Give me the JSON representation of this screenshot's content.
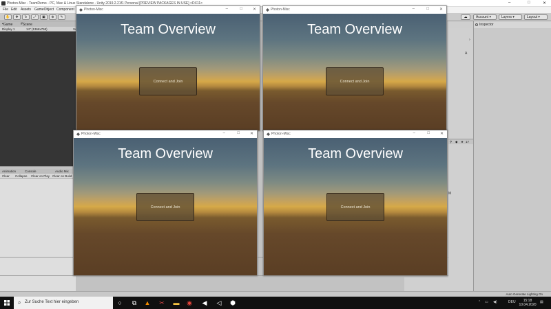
{
  "unity": {
    "title": "Photon-Misc - TeamDemo - PC, Mac & Linux Standalone - Unity 2019.2.21f1 Personal [PREVIEW PACKAGES IN USE] <DX11>",
    "menu": [
      "File",
      "Edit",
      "Assets",
      "GameObject",
      "Component"
    ],
    "toolbar": {
      "account": "Account",
      "layers": "Layers",
      "layout": "Layout"
    },
    "game_tabs": [
      "Game",
      "Scene"
    ],
    "display": "Display 1",
    "resolution": "14\" (1366x768)",
    "scale_prefix": "Sc",
    "console_tabs": [
      "Animation",
      "Console",
      "Audio Mix"
    ],
    "console_buttons": [
      "Clear",
      "Collapse",
      "Clear on Play",
      "Clear on Build"
    ],
    "inspector_tab": "Inspector",
    "project_count": "17",
    "status": "Auto Generate Lighting On"
  },
  "game_windows": [
    {
      "title": "Photon-Misc",
      "heading": "Team Overview",
      "button": "Connect and Join"
    },
    {
      "title": "Photon-Misc",
      "heading": "Team Overview",
      "button": "Connect and Join"
    },
    {
      "title": "Photon-Misc",
      "heading": "Team Overview",
      "button": "Connect and Join"
    },
    {
      "title": "Photon-Misc",
      "heading": "Team Overview",
      "button": "Connect and Join"
    }
  ],
  "taskbar": {
    "search_placeholder": "Zur Suche Text hier eingeben",
    "lang": "DEU",
    "time": "15:18",
    "date": "10.04.2020"
  },
  "colors": {
    "sky_top": "#4a6073",
    "horizon": "#d6a948",
    "ground": "#5a3e24",
    "taskbar": "#101010"
  }
}
